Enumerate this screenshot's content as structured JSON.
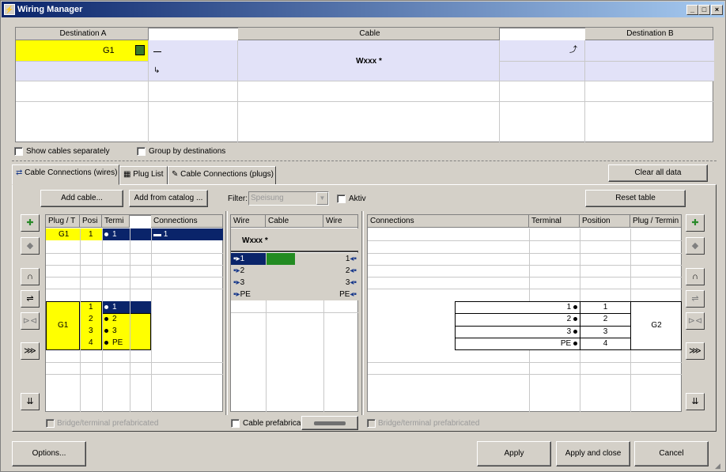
{
  "window": {
    "title": "Wiring Manager"
  },
  "top_table": {
    "headers": [
      "Destination A",
      "",
      "Cable",
      "",
      "Destination B"
    ],
    "dest_a_value": "G1",
    "cable_value": "Wxxx *"
  },
  "options": {
    "show_cables_separately": "Show cables separately",
    "group_by_destinations": "Group by destinations"
  },
  "tabs": [
    "Cable Connections (wires)",
    "Plug List",
    "Cable Connections (plugs)"
  ],
  "buttons": {
    "clear_all": "Clear all data",
    "add_cable": "Add cable...",
    "add_from_catalog": "Add from catalog ...",
    "reset_table": "Reset table",
    "options": "Options...",
    "apply": "Apply",
    "apply_close": "Apply and close",
    "cancel": "Cancel"
  },
  "filter": {
    "label": "Filter:",
    "value": "Speisung",
    "aktiv": "Aktiv"
  },
  "left_table": {
    "headers": [
      "Plug / T",
      "Posi",
      "Termi",
      "",
      "Connections"
    ],
    "top_row": {
      "plug": "G1",
      "pos": "1",
      "term": "1",
      "conn": "1"
    },
    "group_plug": "G1",
    "rows": [
      {
        "pos": "1",
        "term": "1"
      },
      {
        "pos": "2",
        "term": "2"
      },
      {
        "pos": "3",
        "term": "3"
      },
      {
        "pos": "4",
        "term": "PE"
      }
    ],
    "bridge": "Bridge/terminal prefabricated"
  },
  "middle_table": {
    "headers": [
      "Wire",
      "Cable",
      "Wire"
    ],
    "cable": "Wxxx *",
    "rows": [
      {
        "left": "1",
        "right": "1"
      },
      {
        "left": "2",
        "right": "2"
      },
      {
        "left": "3",
        "right": "3"
      },
      {
        "left": "PE",
        "right": "PE"
      }
    ],
    "prefab": "Cable prefabricated"
  },
  "right_table": {
    "headers": [
      "Connections",
      "Terminal",
      "Position",
      "Plug / Termin"
    ],
    "rows": [
      {
        "term": "1",
        "pos": "1"
      },
      {
        "term": "2",
        "pos": "2"
      },
      {
        "term": "3",
        "pos": "3"
      },
      {
        "term": "PE",
        "pos": "4"
      }
    ],
    "plug": "G2",
    "bridge": "Bridge/terminal prefabricated"
  }
}
